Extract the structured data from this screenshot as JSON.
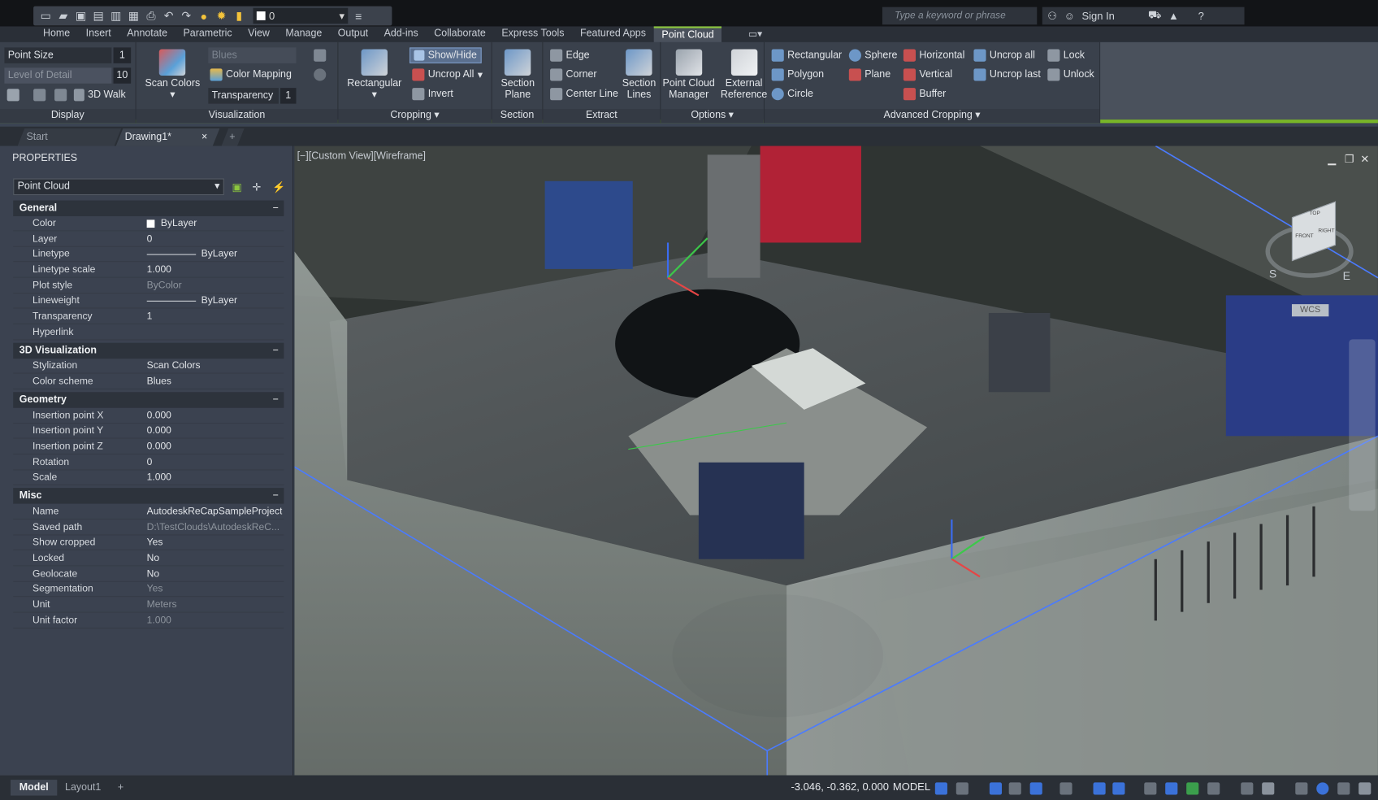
{
  "search": {
    "placeholder": "Type a keyword or phrase"
  },
  "account": {
    "signin": "Sign In"
  },
  "qat": {
    "layer": "0"
  },
  "ribbon_tabs": [
    "Home",
    "Insert",
    "Annotate",
    "Parametric",
    "View",
    "Manage",
    "Output",
    "Add-ins",
    "Collaborate",
    "Express Tools",
    "Featured Apps",
    "Point Cloud"
  ],
  "active_tab": "Point Cloud",
  "display": {
    "point_size_label": "Point Size",
    "point_size_value": "1",
    "lod_label": "Level of Detail",
    "lod_value": "10",
    "walk_label": "3D Walk",
    "title": "Display"
  },
  "visualization": {
    "scan_colors": "Scan Colors",
    "scheme": "Blues",
    "color_mapping": "Color Mapping",
    "transparency_label": "Transparency",
    "transparency_value": "1",
    "title": "Visualization"
  },
  "cropping": {
    "rectangular": "Rectangular",
    "show_hide": "Show/Hide",
    "uncrop_all": "Uncrop All",
    "invert": "Invert",
    "title": "Cropping"
  },
  "section": {
    "section_plane_1": "Section",
    "section_plane_2": "Plane",
    "title": "Section"
  },
  "extract": {
    "edge": "Edge",
    "corner": "Corner",
    "center_line": "Center Line",
    "section_lines_1": "Section",
    "section_lines_2": "Lines",
    "title": "Extract"
  },
  "options": {
    "manager_1": "Point Cloud",
    "manager_2": "Manager",
    "extref_1": "External",
    "extref_2": "Reference",
    "title": "Options"
  },
  "advanced": {
    "rectangular": "Rectangular",
    "polygon": "Polygon",
    "circle": "Circle",
    "sphere": "Sphere",
    "plane": "Plane",
    "horizontal": "Horizontal",
    "vertical": "Vertical",
    "buffer": "Buffer",
    "uncrop_all": "Uncrop all",
    "uncrop_last": "Uncrop last",
    "lock": "Lock",
    "unlock": "Unlock",
    "title": "Advanced Cropping"
  },
  "doc_tabs": {
    "start": "Start",
    "drawing": "Drawing1*"
  },
  "properties": {
    "title": "PROPERTIES",
    "object": "Point Cloud",
    "general": {
      "title": "General",
      "color_l": "Color",
      "color": "ByLayer",
      "layer_l": "Layer",
      "layer": "0",
      "linetype_l": "Linetype",
      "linetype": "ByLayer",
      "ltscale_l": "Linetype scale",
      "ltscale": "1.000",
      "plotstyle_l": "Plot style",
      "plotstyle": "ByColor",
      "lineweight_l": "Lineweight",
      "lineweight": "ByLayer",
      "transparency_l": "Transparency",
      "transparency": "1",
      "hyperlink_l": "Hyperlink",
      "hyperlink": ""
    },
    "viz3d": {
      "title": "3D Visualization",
      "stylization_l": "Stylization",
      "stylization": "Scan Colors",
      "scheme_l": "Color scheme",
      "scheme": "Blues"
    },
    "geometry": {
      "title": "Geometry",
      "ipx_l": "Insertion point X",
      "ipx": "0.000",
      "ipy_l": "Insertion point Y",
      "ipy": "0.000",
      "ipz_l": "Insertion point Z",
      "ipz": "0.000",
      "rot_l": "Rotation",
      "rot": "0",
      "scale_l": "Scale",
      "scale": "1.000"
    },
    "misc": {
      "title": "Misc",
      "name_l": "Name",
      "name": "AutodeskReCapSampleProject",
      "path_l": "Saved path",
      "path": "D:\\TestClouds\\AutodeskReC...",
      "showcrop_l": "Show cropped",
      "showcrop": "Yes",
      "locked_l": "Locked",
      "locked": "No",
      "geoloc_l": "Geolocate",
      "geoloc": "No",
      "seg_l": "Segmentation",
      "seg": "Yes",
      "unit_l": "Unit",
      "unit": "Meters",
      "unitf_l": "Unit factor",
      "unitf": "1.000"
    }
  },
  "viewport": {
    "label": "[−][Custom View][Wireframe]",
    "wcs": "WCS",
    "cube_top": "TOP",
    "cube_right": "RIGHT",
    "cube_front": "FRONT",
    "compass_s": "S",
    "compass_e": "E"
  },
  "layout_tabs": {
    "model": "Model",
    "layout1": "Layout1"
  },
  "status": {
    "coords": "-3.046, -0.362, 0.000",
    "model": "MODEL"
  }
}
